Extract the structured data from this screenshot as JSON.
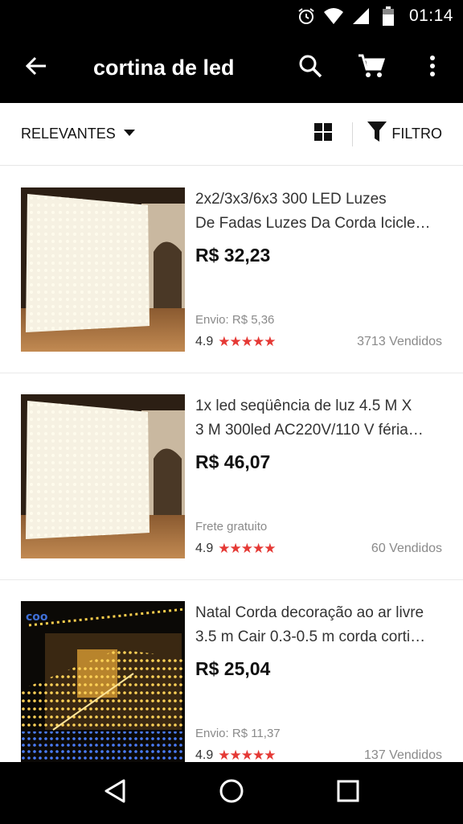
{
  "status_bar": {
    "icons": [
      "alarm-icon",
      "wifi-icon",
      "signal-icon",
      "battery-icon"
    ],
    "time": "01:14"
  },
  "app_bar": {
    "title": "cortina de led",
    "icons": [
      "back-arrow-icon",
      "search-icon",
      "cart-icon",
      "more-vert-icon"
    ]
  },
  "toolbar": {
    "sort_label": "RELEVANTES",
    "filter_label": "FILTRO"
  },
  "products": [
    {
      "title_line1": "2x2/3x3/6x3 300 LED Luzes",
      "title_line2": "De Fadas Luzes Da Corda Icicle…",
      "price": "R$ 32,23",
      "shipping": "Envio: R$ 5,36",
      "rating": "4.9",
      "stars": 5,
      "sold": "3713 Vendidos"
    },
    {
      "title_line1": "1x led seqüência de luz 4.5 M X",
      "title_line2": "3 M 300led AC220V/110 V féria…",
      "price": "R$ 46,07",
      "shipping": "Frete gratuito",
      "rating": "4.9",
      "stars": 5,
      "sold": "60 Vendidos"
    },
    {
      "title_line1": "Natal Corda decoração ao ar livre",
      "title_line2": "3.5 m Cair 0.3-0.5 m corda corti…",
      "price": "R$ 25,04",
      "shipping": "Envio: R$ 11,37",
      "rating": "4.9",
      "stars": 5,
      "sold": "137 Vendidos"
    }
  ],
  "nav_bar": {
    "icons": [
      "nav-back-icon",
      "nav-home-icon",
      "nav-recents-icon"
    ]
  },
  "colors": {
    "bar_bg": "#000000",
    "star": "#e53935",
    "muted_text": "#8a8a8a"
  }
}
